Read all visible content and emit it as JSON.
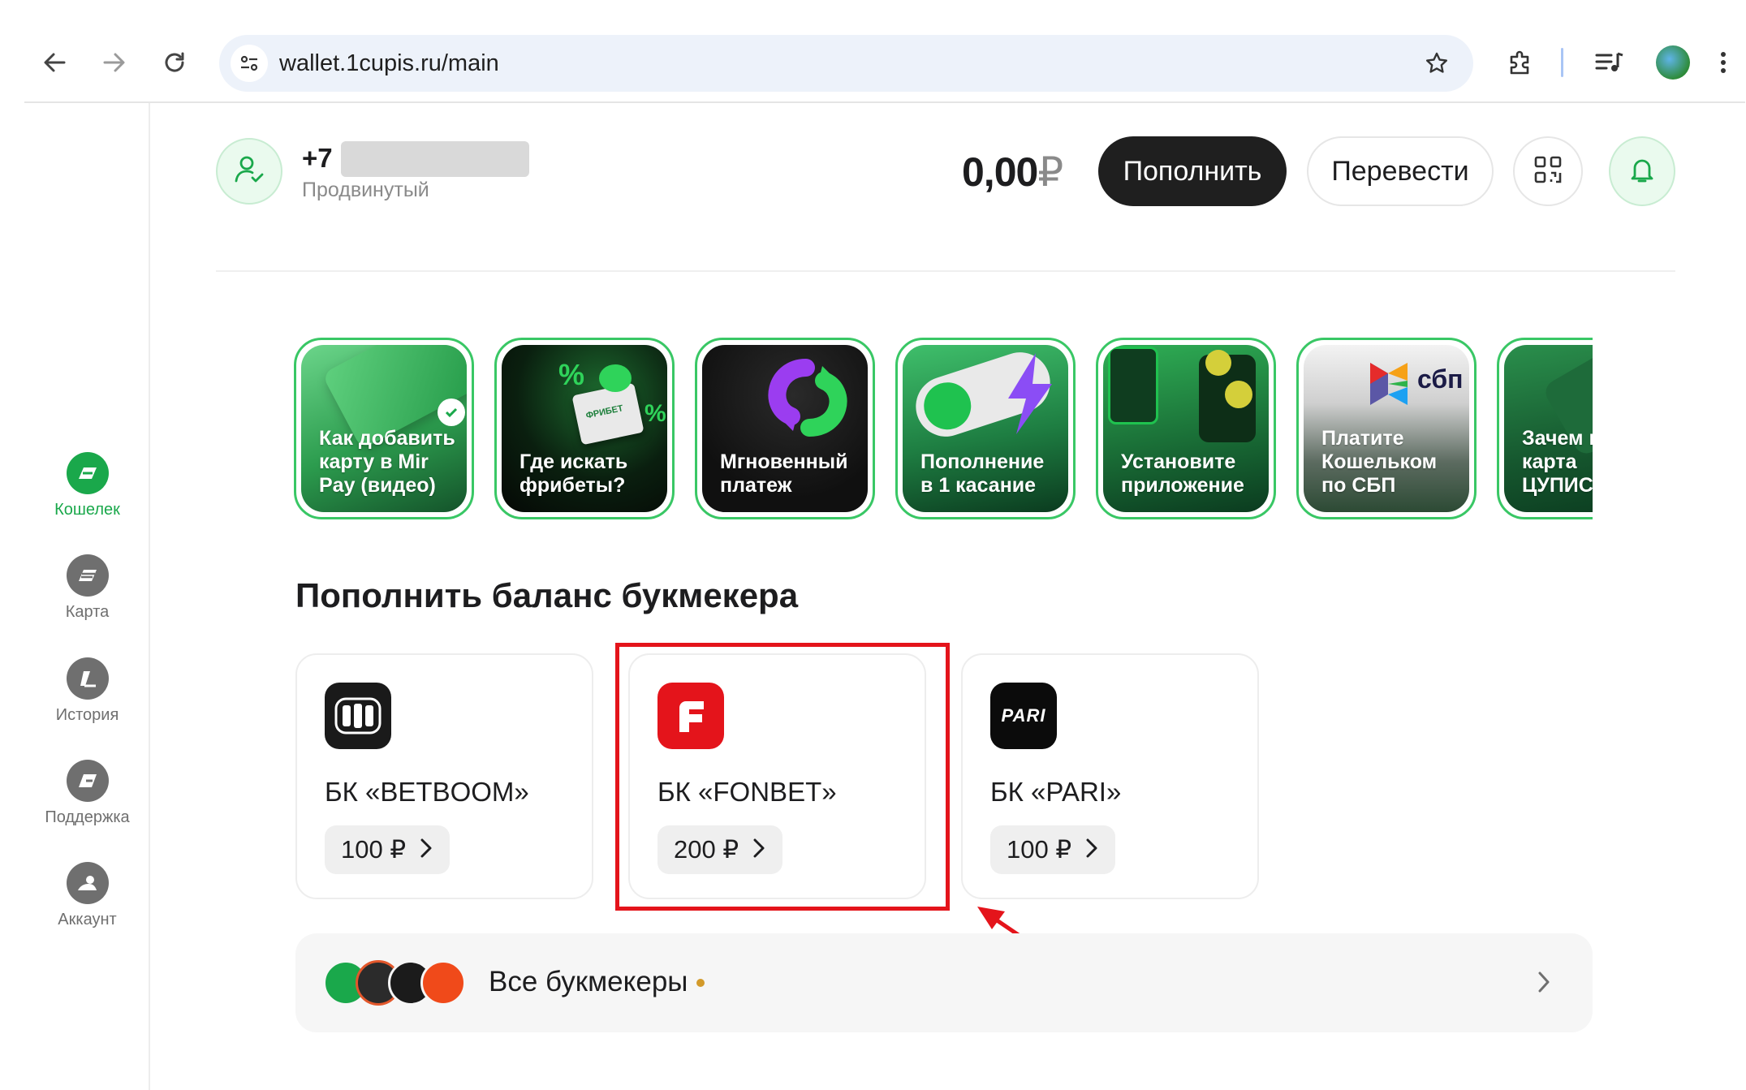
{
  "browser": {
    "url": "wallet.1cupis.ru/main",
    "icons": [
      "back-arrow-icon",
      "forward-arrow-icon",
      "reload-icon",
      "site-settings-icon",
      "bookmark-star-icon",
      "extensions-icon",
      "reading-list-icon",
      "profile-avatar-icon",
      "menu-kebab-icon"
    ]
  },
  "sidebar": {
    "items": [
      {
        "label": "Кошелек",
        "icon": "wallet-icon",
        "active": true
      },
      {
        "label": "Карта",
        "icon": "card-icon",
        "active": false
      },
      {
        "label": "История",
        "icon": "history-icon",
        "active": false
      },
      {
        "label": "Поддержка",
        "icon": "support-icon",
        "active": false
      },
      {
        "label": "Аккаунт",
        "icon": "account-icon",
        "active": false
      }
    ]
  },
  "header": {
    "phone_prefix": "+7",
    "status": "Продвинутый",
    "balance_amount": "0,00",
    "balance_currency": "₽",
    "topup_label": "Пополнить",
    "transfer_label": "Перевести"
  },
  "stories": [
    {
      "title": "Как добавить\nкарту в Mir\nPay (видео)"
    },
    {
      "title": "Где искать\nфрибеты?"
    },
    {
      "title": "Мгновенный\nплатеж"
    },
    {
      "title": "Пополнение\nв 1 касание"
    },
    {
      "title": "Установите\nприложение"
    },
    {
      "title": "Платите\nКошельком\nпо СБП"
    },
    {
      "title": "Зачем в\nкарта\nЦУПИС?"
    }
  ],
  "story_badges": {
    "sbp": "сбп",
    "freebet": "ФРИБЕТ"
  },
  "section": {
    "title": "Пополнить баланс букмекера"
  },
  "bookmakers": [
    {
      "name": "БК «BETBOOM»",
      "amount": "100 ₽",
      "logo": "betboom-logo-icon",
      "logo_color": "#1a1a1a"
    },
    {
      "name": "БК «FONBET»",
      "amount": "200 ₽",
      "logo": "fonbet-logo-icon",
      "logo_color": "#e4141b"
    },
    {
      "name": "БК «PARI»",
      "amount": "100 ₽",
      "logo": "pari-logo-icon",
      "logo_color": "#0b0b0b",
      "logo_text": "PARI"
    }
  ],
  "all_bookmakers": {
    "label": "Все букмекеры"
  },
  "colors": {
    "accent_green": "#1aa84b",
    "highlight_red": "#e4141b",
    "dark_button": "#1f1f1f"
  }
}
